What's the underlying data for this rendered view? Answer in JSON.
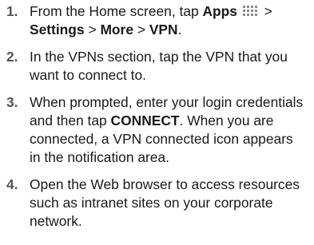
{
  "steps": [
    {
      "number": "1.",
      "t1": "From the Home screen, tap ",
      "b1": "Apps",
      "t2": " > ",
      "b2": "Settings",
      "t3": " > ",
      "b3": "More",
      "t4": " > ",
      "b4": "VPN",
      "t5": ".",
      "icon": "apps-grid-icon"
    },
    {
      "number": "2.",
      "text": "In the VPNs section, tap the VPN that you want to connect to."
    },
    {
      "number": "3.",
      "t1": "When prompted, enter your login credentials  and then tap ",
      "b1": "CONNECT",
      "t2": ". When you are connected, a VPN connected icon appears in the notification area."
    },
    {
      "number": "4.",
      "text": "Open the Web browser to access resources such as intranet sites on your corporate network."
    }
  ]
}
